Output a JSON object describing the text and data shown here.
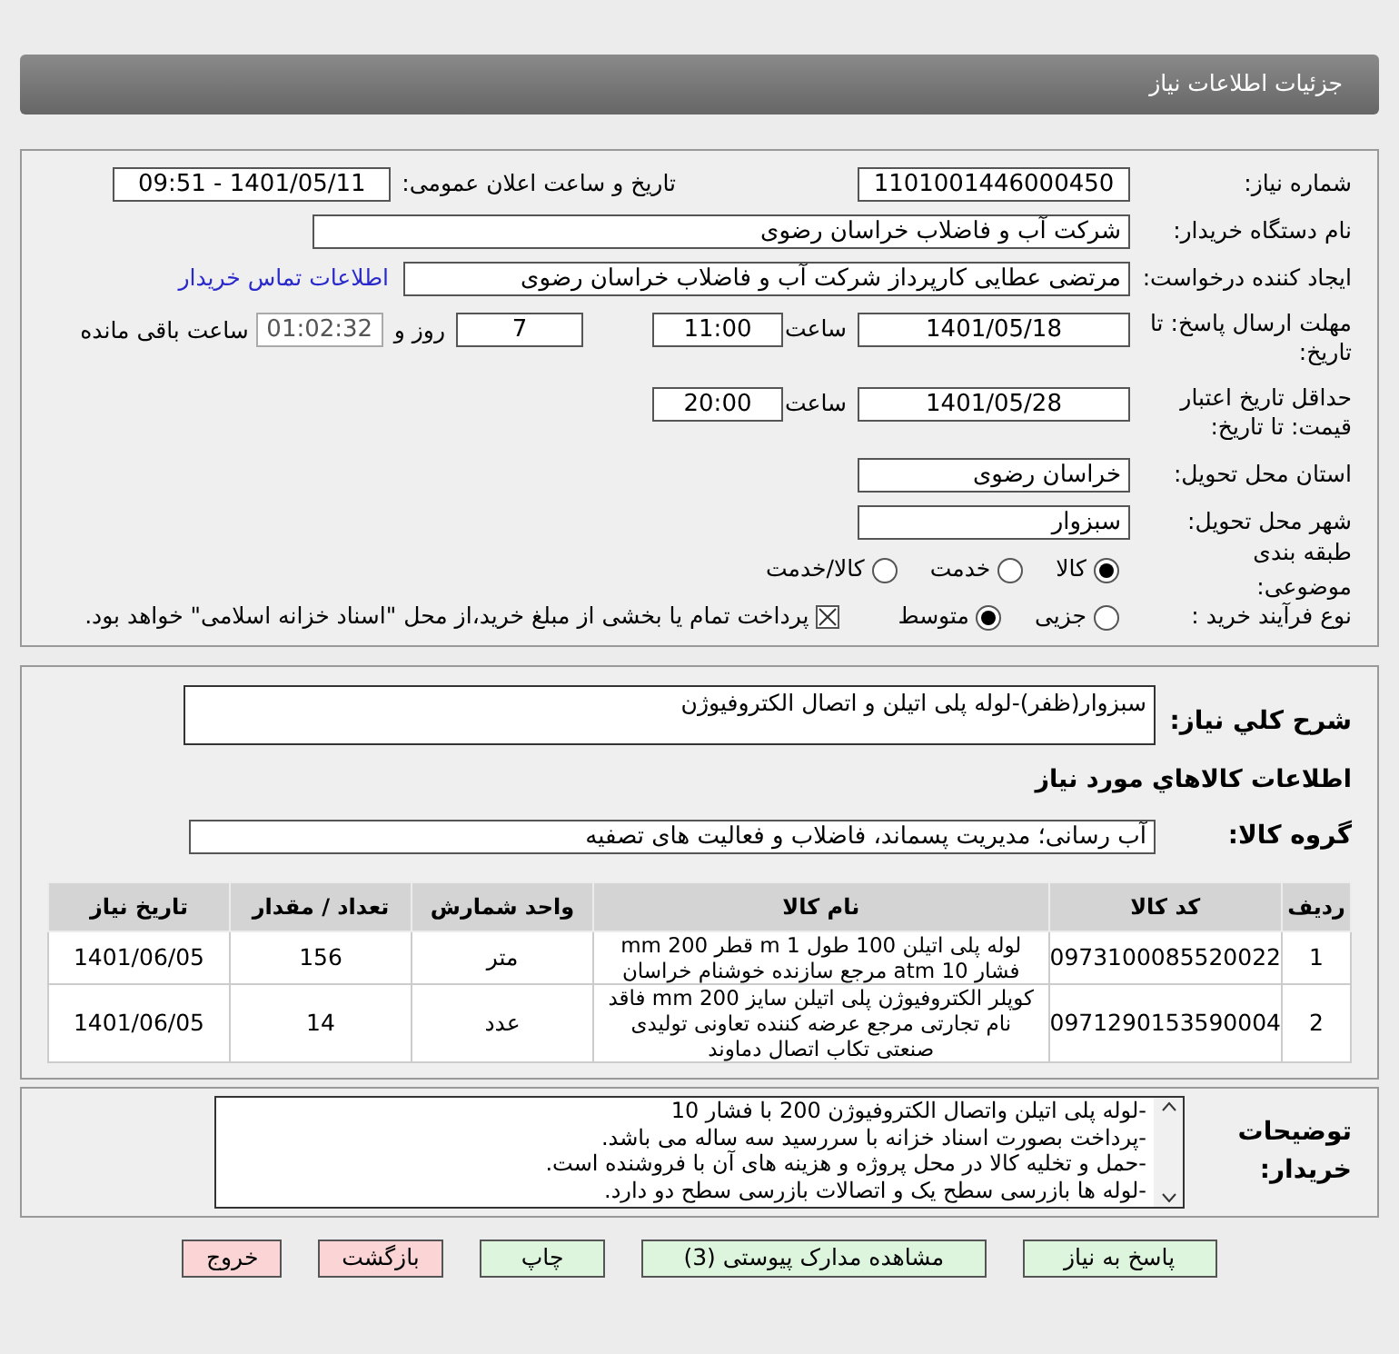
{
  "title": "جزئیات اطلاعات نیاز",
  "need_number": {
    "label": "شماره نیاز:",
    "value": "1101001446000450"
  },
  "announce": {
    "label": "تاریخ و ساعت اعلان عمومی:",
    "value": "1401/05/11 - 09:51"
  },
  "buyer": {
    "label": "نام دستگاه خریدار:",
    "value": "شرکت آب و فاضلاب خراسان رضوی"
  },
  "requester": {
    "label": "ایجاد کننده درخواست:",
    "value": "مرتضی عطایی کارپرداز شرکت آب و فاضلاب خراسان رضوی",
    "link": "اطلاعات تماس خریدار"
  },
  "deadline": {
    "label": "مهلت ارسال پاسخ: تا تاریخ:",
    "date": "1401/05/18",
    "time_label": "ساعت",
    "time": "11:00",
    "days": "7",
    "days_label": "روز و",
    "remaining": "01:02:32",
    "remaining_label": "ساعت باقی مانده"
  },
  "validity": {
    "label": "حداقل تاریخ اعتبار قیمت: تا تاریخ:",
    "date": "1401/05/28",
    "time_label": "ساعت",
    "time": "20:00"
  },
  "province": {
    "label": "استان محل تحویل:",
    "value": "خراسان رضوی"
  },
  "city": {
    "label": "شهر محل تحویل:",
    "value": "سبزوار"
  },
  "category": {
    "label": "طبقه بندی موضوعی:",
    "options": [
      {
        "label": "کالا",
        "selected": true
      },
      {
        "label": "خدمت",
        "selected": false
      },
      {
        "label": "کالا/خدمت",
        "selected": false
      }
    ]
  },
  "process": {
    "label": "نوع فرآیند خرید :",
    "options": [
      {
        "label": "جزیی",
        "selected": false
      },
      {
        "label": "متوسط",
        "selected": true
      }
    ],
    "payment": {
      "label": "پرداخت تمام یا بخشی از مبلغ خرید،از محل \"اسناد خزانه اسلامی\" خواهد بود.",
      "checked": true
    }
  },
  "summary": {
    "label": "شرح کلي نياز:",
    "value": "سبزوار(ظفر)-لوله پلی اتیلن و اتصال الکتروفیوژن"
  },
  "goods_heading": "اطلاعات کالاهاي مورد نياز",
  "goods_group": {
    "label": "گروه کالا:",
    "value": "آب رسانی؛ مدیریت پسماند، فاضلاب و فعالیت های تصفیه"
  },
  "table": {
    "columns": [
      "ردیف",
      "کد کالا",
      "نام کالا",
      "واحد شمارش",
      "تعداد / مقدار",
      "تاریخ نیاز"
    ],
    "rows": [
      [
        "1",
        "0973100085520022",
        "لوله پلی اتیلن 100 طول 1 m قطر 200 mm فشار 10 atm مرجع سازنده خوشنام خراسان",
        "متر",
        "156",
        "1401/06/05"
      ],
      [
        "2",
        "0971290153590004",
        "کوپلر الکتروفیوژن پلی اتیلن سایز 200 mm فاقد نام تجارتی مرجع عرضه کننده تعاونی تولیدی صنعتی تکاب اتصال دماوند",
        "عدد",
        "14",
        "1401/06/05"
      ]
    ]
  },
  "notes": {
    "label": "توضیحات خریدار:",
    "lines": [
      "-لوله پلی اتیلن واتصال الکتروفیوژن 200 با فشار 10",
      "-پرداخت بصورت اسناد خزانه با سررسید سه ساله می باشد.",
      "-حمل و تخلیه کالا در محل پروژه و هزینه های آن با فروشنده است.",
      "-لوله ها بازرسی سطح یک و اتصالات بازرسی سطح دو دارد."
    ]
  },
  "buttons": [
    {
      "label": "پاسخ به نیاز",
      "kind": "action"
    },
    {
      "label": "مشاهده مدارک پیوستی (3)",
      "kind": "action"
    },
    {
      "label": "چاپ",
      "kind": "action"
    },
    {
      "label": "بازگشت",
      "kind": "exit"
    },
    {
      "label": "خروج",
      "kind": "exit"
    }
  ]
}
